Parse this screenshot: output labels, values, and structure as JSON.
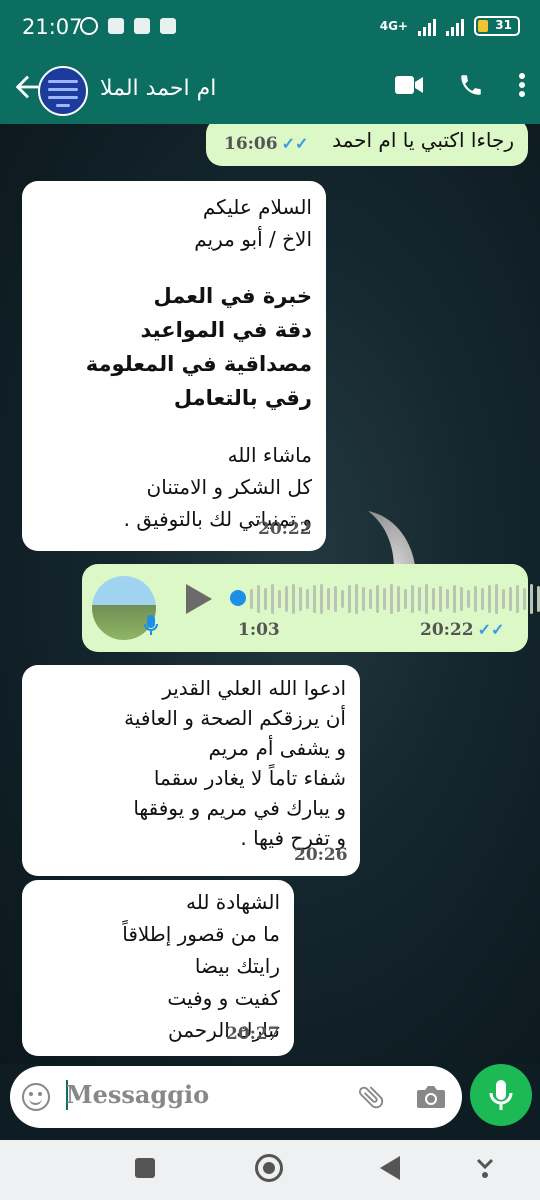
{
  "status_bar": {
    "time": "21:07",
    "network": "4G+",
    "battery": "31"
  },
  "header": {
    "contact_name": "ام احمد الملا",
    "icons": [
      "back-arrow-icon",
      "avatar",
      "video-call-icon",
      "phone-icon",
      "more-options-icon"
    ]
  },
  "messages": [
    {
      "type": "text",
      "direction": "outgoing",
      "text": "رجاءا اكتبي يا ام احمد",
      "time": "16:06",
      "read": true
    },
    {
      "type": "text",
      "direction": "incoming",
      "line1": "السلام عليكم",
      "line2": "الاخ / أبو مريم",
      "bold": "خبرة في العمل\nدقة في المواعيد\nمصداقية في المعلومة\nرقي بالتعامل",
      "tail": "ماشاء الله\nكل الشكر و الامتنان\nو تمنياتي لك بالتوفيق .",
      "time": "20:22"
    },
    {
      "type": "voice",
      "direction": "outgoing",
      "duration": "1:03",
      "time": "20:22",
      "read": true
    },
    {
      "type": "text",
      "direction": "incoming",
      "text": "ادعوا الله العلي القدير\nأن يرزقكم الصحة و العافية\nو يشفى أم مريم\nشفاء تاماً لا يغادر سقما\nو يبارك في مريم و يوفقها\nو تفرح فيها .",
      "time": "20:26"
    },
    {
      "type": "text",
      "direction": "incoming",
      "text": "الشهادة لله\nما من قصور إطلاقاً\nرايتك بيضا\nكفيت و وفيت\nتبارك الرحمن",
      "time": "20:27"
    }
  ],
  "input": {
    "placeholder": "Messaggio"
  },
  "colors": {
    "header": "#0b6e61",
    "outgoing_bubble": "#dcf8c6",
    "incoming_bubble": "#ffffff",
    "mic_button": "#1db954",
    "read_ticks": "#3b9be0"
  }
}
